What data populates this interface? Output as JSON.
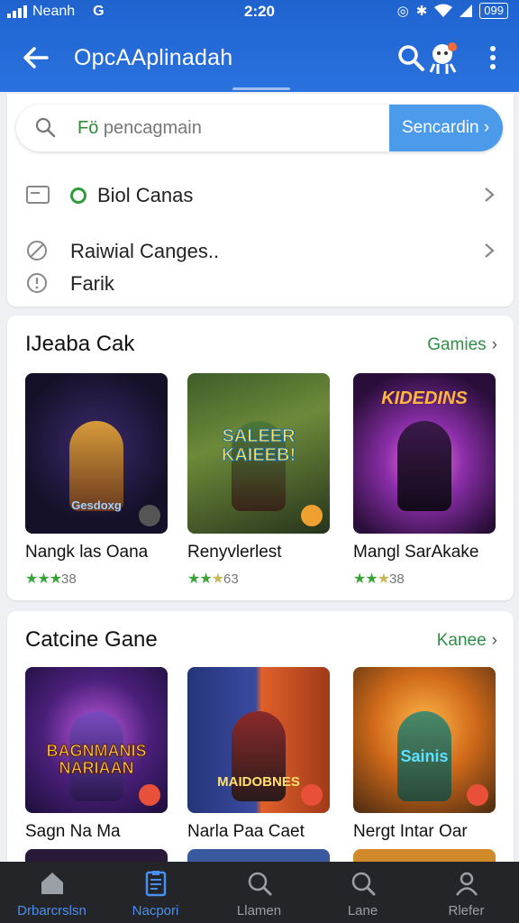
{
  "status": {
    "carrier": "Neanh",
    "time": "2:20",
    "battery": "099"
  },
  "appbar": {
    "title": "OpcAAplinadah"
  },
  "search": {
    "placeholder_prefix": "Fö",
    "placeholder": "pencagmain",
    "button": "Sencardin ›"
  },
  "menu": {
    "items": [
      {
        "label": "Biol Canas",
        "icon": "card-icon"
      },
      {
        "label": "Raiwial Canges..",
        "icon": "no-entry-icon"
      },
      {
        "label": "Farik",
        "icon": "info-icon"
      }
    ]
  },
  "sections": [
    {
      "title": "IJeaba Cak",
      "more": "Gamies",
      "games": [
        {
          "name": "Nangk las Oana",
          "stars": "★★★",
          "rating": "38",
          "logo": "Gesdoxg"
        },
        {
          "name": "Renyvlerlest",
          "stars": "★★",
          "dim": "★",
          "rating": "63",
          "logo": "SALEER KAIEEB!"
        },
        {
          "name": "Mangl SarAkake",
          "stars": "★★",
          "dim": "★",
          "rating": "38",
          "logo": "KIDEDINS"
        }
      ]
    },
    {
      "title": "Catcine Gane",
      "more": "Kanee",
      "games": [
        {
          "name": "Sagn Na Ma",
          "logo": "BAGNMANIS NARIAAN"
        },
        {
          "name": "Narla Paa Caet",
          "logo": "MAIDOBNES"
        },
        {
          "name": "Nergt Intar Oar",
          "logo": "Sainis"
        }
      ]
    }
  ],
  "bottom_nav": [
    {
      "label": "Drbarcrslsn",
      "icon": "home-icon",
      "active": false
    },
    {
      "label": "Nacpori",
      "icon": "clipboard-icon",
      "active": true
    },
    {
      "label": "Llamen",
      "icon": "search-icon",
      "active": false
    },
    {
      "label": "Lane",
      "icon": "search-icon",
      "active": false
    },
    {
      "label": "Rlefer",
      "icon": "profile-icon",
      "active": false
    }
  ],
  "colors": {
    "primary": "#2a72df",
    "accent": "#4b9bea",
    "green": "#2e8f46",
    "nav_bg": "#232528"
  }
}
